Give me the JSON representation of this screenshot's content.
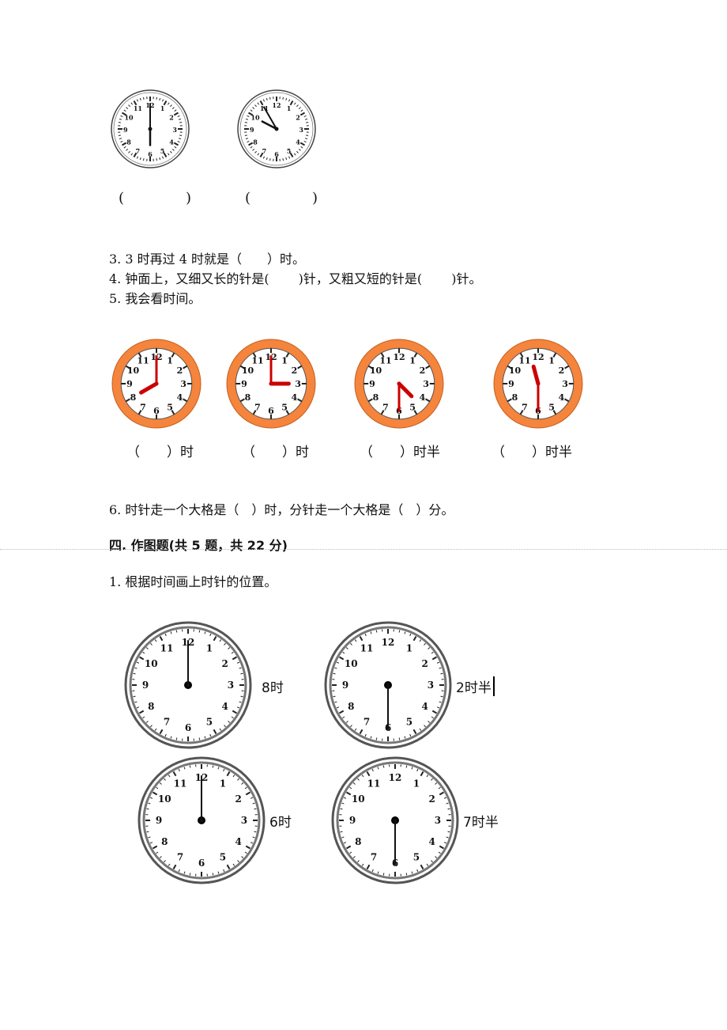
{
  "top_clocks": {
    "clocks": [
      {
        "hour": 6,
        "minute": 0
      },
      {
        "hour": 9,
        "minute": 55
      }
    ],
    "answers": [
      "(　　　)",
      "(　　　)"
    ]
  },
  "questions": {
    "q3": "3. 3 时再过 4 时就是（　　）时。",
    "q4": "4. 钟面上，又细又长的针是(　　 )针，又粗又短的针是(　　 )针。",
    "q5": "5. 我会看时间。",
    "q6": "6. 时针走一个大格是（　）时，分针走一个大格是（　）分。"
  },
  "orange_clocks": {
    "colors": {
      "rim": "#f5843c",
      "hand": "#cc0000"
    },
    "clocks": [
      {
        "hour": 8,
        "minute": 0
      },
      {
        "hour": 3,
        "minute": 0
      },
      {
        "hour": 4,
        "minute": 30
      },
      {
        "hour": 11,
        "minute": 30
      }
    ],
    "answers": [
      "（　　）时",
      "（　　）时",
      "（　　）时半",
      "（　　）时半"
    ]
  },
  "section4": {
    "heading": "四. 作图题(共 5 题，共 22 分)",
    "q1": "1. 根据时间画上时针的位置。"
  },
  "drawing_clocks": {
    "clocks": [
      {
        "minute": 0,
        "label": "8时"
      },
      {
        "minute": 30,
        "label": "2时半"
      },
      {
        "minute": 0,
        "label": "6时"
      },
      {
        "minute": 30,
        "label": "7时半"
      }
    ]
  }
}
